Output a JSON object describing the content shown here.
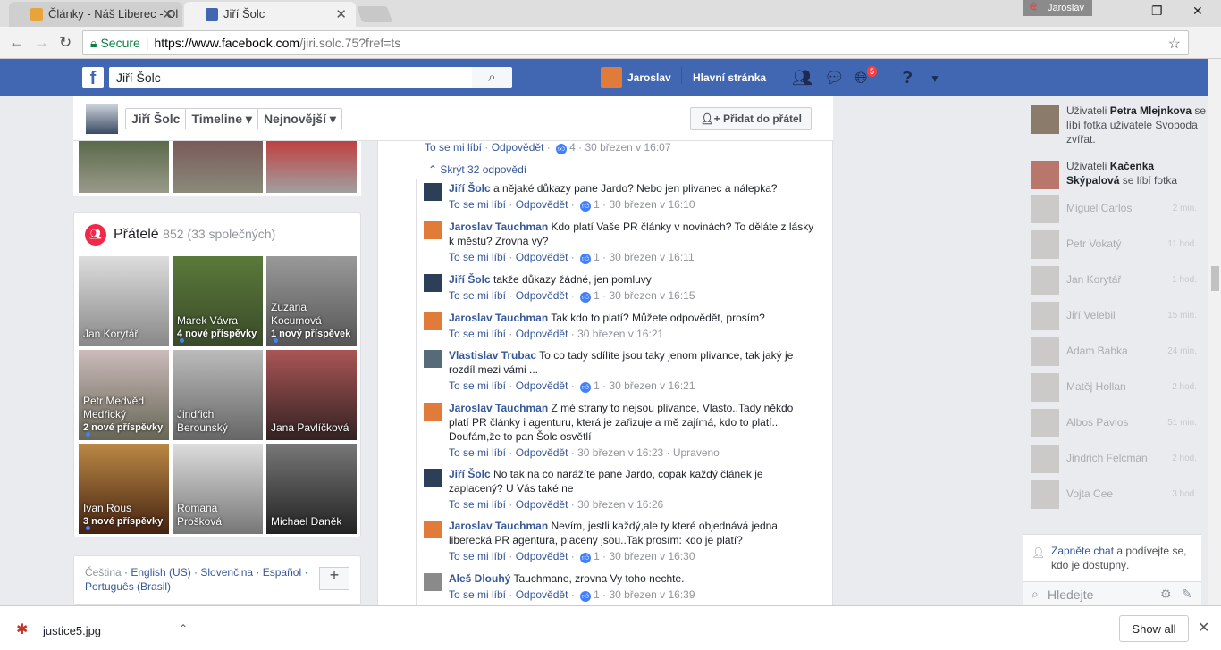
{
  "browser": {
    "tabs": [
      {
        "title": "Články - Náš Liberec - Ol",
        "close": "✕"
      },
      {
        "title": "Jiří Šolc",
        "close": "✕"
      }
    ],
    "profile_name": "Jaroslav",
    "secure_label": "Secure",
    "url_host": "https://www.facebook.com",
    "url_path": "/jiri.solc.75?fref=ts",
    "window_buttons": [
      "—",
      "❐",
      "✕"
    ]
  },
  "fb": {
    "search_value": "Jiří Šolc",
    "me_name": "Jaroslav",
    "home_label": "Hlavní stránka",
    "notif_count": "5"
  },
  "profile": {
    "name": "Jiří Šolc",
    "timeline": "Timeline ▾",
    "newest": "Nejnovější ▾",
    "add_friend": "Přidat do přátel"
  },
  "friends": {
    "title": "Přátelé",
    "count": "852 (33 společných)",
    "items": [
      {
        "name": "Jan Korytář",
        "sub": ""
      },
      {
        "name": "Marek Vávra",
        "sub": "4 nové příspěvky"
      },
      {
        "name": "Zuzana Kocumová",
        "sub": "1 nový příspěvek"
      },
      {
        "name": "Petr Medvěd Medřický",
        "sub": "2 nové příspěvky"
      },
      {
        "name": "Jindřich Berounský",
        "sub": ""
      },
      {
        "name": "Jana Pavlíčková",
        "sub": ""
      },
      {
        "name": "Ivan Rous",
        "sub": "3 nové příspěvky"
      },
      {
        "name": "Romana Prošková",
        "sub": ""
      },
      {
        "name": "Michael Daněk",
        "sub": ""
      }
    ]
  },
  "languages": {
    "current": "Čeština",
    "others": "· English (US) · Slovenčina · Español · Português (Brasil)"
  },
  "comments": {
    "top_meta": {
      "like": "To se mi líbí",
      "reply": "Odpovědět",
      "likes": "4",
      "time": "30 březen v 16:07"
    },
    "hide_label": "Skrýt 32 odpovědí",
    "replies": [
      {
        "author": "Jiří Šolc",
        "text": " a nějaké důkazy pane Jardo? Nebo jen plivanec a nálepka?",
        "likes": "1",
        "time": "30 březen v 16:10"
      },
      {
        "author": "Jaroslav Tauchman",
        "text": " Kdo platí Vaše PR články v novinách? To děláte z lásky k městu? Zrovna vy?",
        "likes": "1",
        "time": "30 březen v 16:11"
      },
      {
        "author": "Jiří Šolc",
        "text": " takže důkazy žádné, jen pomluvy",
        "likes": "1",
        "time": "30 březen v 16:15"
      },
      {
        "author": "Jaroslav Tauchman",
        "text": " Tak kdo to platí? Můžete odpovědět, prosím?",
        "likes": "",
        "time": "30 březen v 16:21"
      },
      {
        "author": "Vlastislav Trubac",
        "text": " To co tady sdílíte jsou taky jenom plivance, tak jaký je rozdíl mezi vámi ...",
        "likes": "1",
        "time": "30 březen v 16:21"
      },
      {
        "author": "Jaroslav Tauchman",
        "text": " Z mé strany to nejsou plivance, Vlasto..Tady někdo platí PR články i agenturu, která je zařizuje a mě zajímá, kdo to platí.. Doufám,že to pan Šolc osvětlí",
        "likes": "",
        "time": "30 březen v 16:23 · Upraveno"
      },
      {
        "author": "Jiří Šolc",
        "text": " No tak na co narážíte pane Jardo, copak každý článek je zaplacený? U Vás také ne",
        "likes": "",
        "time": "30 březen v 16:26"
      },
      {
        "author": "Jaroslav Tauchman",
        "text": " Nevím, jestli každý,ale ty které objednává jedna liberecká PR agentura, placeny jsou..Tak prosím: kdo je platí?",
        "likes": "1",
        "time": "30 březen v 16:30"
      },
      {
        "author": "Aleš Dlouhý",
        "text": " Tauchmane, zrovna Vy toho nechte.",
        "likes": "1",
        "time": "30 březen v 16:39"
      }
    ],
    "like_label": "To se mi líbí",
    "reply_label": "Odpovědět"
  },
  "ticker": [
    {
      "prefix": "Uživateli ",
      "name": "Petra Mlejnkova",
      "rest": " se líbí fotka uživatele Svoboda zvířat."
    },
    {
      "prefix": "Uživateli ",
      "name": "Kačenka Skýpalová",
      "rest": " se líbí fotka"
    }
  ],
  "chat": [
    {
      "name": "Miguel Carlos",
      "time": "2 min."
    },
    {
      "name": "Petr Vokatý",
      "time": "11 hod."
    },
    {
      "name": "Jan Korytář",
      "time": "1 hod."
    },
    {
      "name": "Jiří Velebil",
      "time": "15 min."
    },
    {
      "name": "Adam Babka",
      "time": "24 min."
    },
    {
      "name": "Matěj Hollan",
      "time": "2 hod."
    },
    {
      "name": "Albos Pavlos",
      "time": "51 min."
    },
    {
      "name": "Jindrich Felcman",
      "time": "2 hod."
    },
    {
      "name": "Vojta Cee",
      "time": "3 hod."
    }
  ],
  "chat_prompt": {
    "link": "Zapněte chat",
    "rest": " a podívejte se, kdo je dostupný."
  },
  "chat_search_placeholder": "Hledejte",
  "download": {
    "file": "justice5.jpg",
    "show_all": "Show all"
  }
}
